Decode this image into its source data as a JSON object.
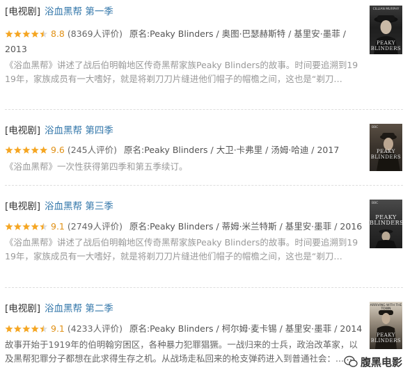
{
  "items": [
    {
      "tag": "[电视剧]",
      "title": "浴血黑帮 第一季",
      "rating_value": 4.5,
      "rating": "8.8",
      "count": "(8369人评价)",
      "orig": "原名:Peaky Blinders / 奥图·巴瑟赫斯特 / 基里安·墨菲 /",
      "orig2": "2013",
      "desc": "《浴血黑帮》讲述了战后伯明翰地区传奇黑帮家族Peaky Blinders的故事。时间要追溯到1919年，家族成员有一大嗜好，就是将剃刀刀片缝进他们帽子的帽檐之间，这也是“剃刀…",
      "poster_label": "PEAKY BLINDERS",
      "poster_top": "CILLIAN MURPHY"
    },
    {
      "tag": "[电视剧]",
      "title": "浴血黑帮 第四季",
      "rating_value": 5,
      "rating": "9.6",
      "count": "(245人评价)",
      "orig": "原名:Peaky Blinders / 大卫·卡弗里 / 汤姆·哈迪 / 2017",
      "desc": "《浴血黑帮》一次性获得第四季和第五季续订。",
      "poster_label": "PEAKY BLINDERS",
      "poster_top": "BBC"
    },
    {
      "tag": "[电视剧]",
      "title": "浴血黑帮 第三季",
      "rating_value": 4.5,
      "rating": "9.1",
      "count": "(2749人评价)",
      "orig": "原名:Peaky Blinders / 蒂姆·米兰特斯 / 基里安·墨菲 / 2016",
      "desc": "《浴血黑帮》讲述了战后伯明翰地区传奇黑帮家族Peaky Blinders的故事。时间要追溯到1919年，家族成员有一大嗜好，就是将剃刀刀片缝进他们帽子的帽檐之间，这也是“剃刀…",
      "poster_label": "PEAKY BLINDERS",
      "poster_top": "BBC"
    },
    {
      "tag": "[电视剧]",
      "title": "浴血黑帮 第二季",
      "rating_value": 4.5,
      "rating": "9.1",
      "count": "(4233人评价)",
      "orig": "原名:Peaky Blinders / 柯尔姆·麦卡锡 / 基里安·墨菲 / 2014",
      "desc": "故事开始于1919年的伯明翰穷困区，各种暴力犯罪猖獗。一战归来的士兵，政治改革家，以及黑帮犯罪分子都想在此求得生存之机。从战场走私回来的枪支弹药进入到普通社会：...",
      "poster_label": "PEAKY BLINDERS",
      "poster_top": "ARRIVING WITH THE TOWN"
    }
  ],
  "watermark": "腹黑电影",
  "colors": {
    "link": "#3377aa",
    "star": "#f5a623",
    "rating": "#e09015"
  }
}
